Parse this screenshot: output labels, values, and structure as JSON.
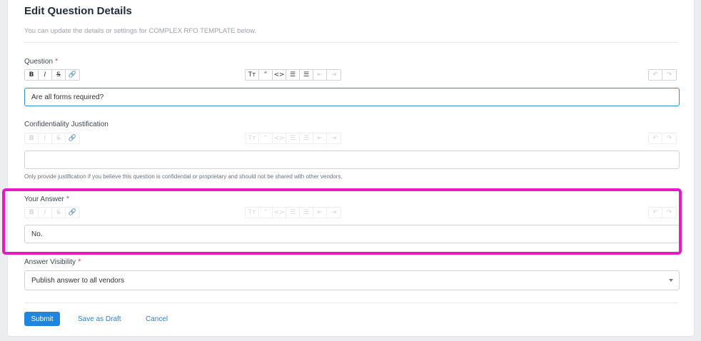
{
  "header": {
    "title": "Edit Question Details",
    "subtitle": "You can update the details or settings for COMPLEX RFO TEMPLATE below."
  },
  "required_mark": "*",
  "toolbar_icons": {
    "left": [
      "B",
      "I",
      "S",
      "🔗"
    ],
    "left_names": [
      "bold-icon",
      "italic-icon",
      "strikethrough-icon",
      "link-icon"
    ],
    "mid": [
      "Τт",
      "”",
      "<>",
      "☰",
      "☰",
      "⇤",
      "⇥"
    ],
    "mid_names": [
      "heading-icon",
      "quote-icon",
      "code-icon",
      "bullet-list-icon",
      "numbered-list-icon",
      "outdent-icon",
      "indent-icon"
    ],
    "right": [
      "↶",
      "↷"
    ],
    "right_names": [
      "undo-icon",
      "redo-icon"
    ]
  },
  "question": {
    "label": "Question",
    "value": "Are all forms required?"
  },
  "confidentiality": {
    "label": "Confidentiality Justification",
    "value": "",
    "help": "Only provide justification if you believe this question is confidential or proprietary and should not be shared with other vendors."
  },
  "answer": {
    "label": "Your Answer",
    "value": "No."
  },
  "visibility": {
    "label": "Answer Visibility",
    "selected": "Publish answer to all vendors"
  },
  "actions": {
    "submit": "Submit",
    "draft": "Save as Draft",
    "cancel": "Cancel"
  },
  "colors": {
    "primary": "#1f86e0",
    "highlight": "#e619c3",
    "required": "#e0457b"
  }
}
